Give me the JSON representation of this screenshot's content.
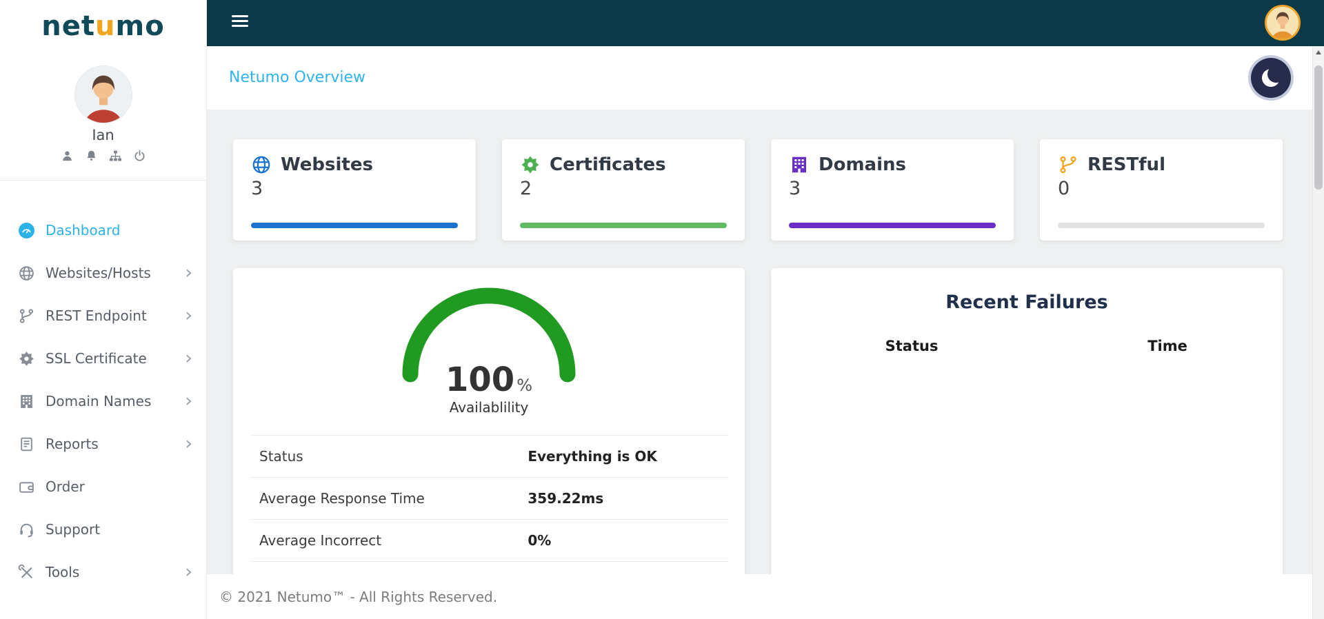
{
  "colors": {
    "topbar_bg": "#0b3948",
    "accent": "#2bb2e6",
    "title": "#2eb4ea"
  },
  "sidebar": {
    "logo": {
      "part1": "net",
      "part2": "u",
      "part3": "mo"
    },
    "user": {
      "name": "Ian"
    },
    "items": [
      {
        "label": "Dashboard",
        "icon": "speedometer-icon",
        "active": true,
        "chevron": false
      },
      {
        "label": "Websites/Hosts",
        "icon": "globe-icon",
        "active": false,
        "chevron": true
      },
      {
        "label": "REST Endpoint",
        "icon": "branch-icon",
        "active": false,
        "chevron": true
      },
      {
        "label": "SSL Certificate",
        "icon": "certificate-icon",
        "active": false,
        "chevron": true
      },
      {
        "label": "Domain Names",
        "icon": "building-icon",
        "active": false,
        "chevron": true
      },
      {
        "label": "Reports",
        "icon": "report-icon",
        "active": false,
        "chevron": true
      },
      {
        "label": "Order",
        "icon": "wallet-icon",
        "active": false,
        "chevron": false
      },
      {
        "label": "Support",
        "icon": "headset-icon",
        "active": false,
        "chevron": false
      },
      {
        "label": "Tools",
        "icon": "tools-icon",
        "active": false,
        "chevron": true
      }
    ]
  },
  "topbar": {
    "menu_icon": "hamburger-icon",
    "avatar_icon": "user-avatar"
  },
  "main": {
    "title": "Netumo Overview",
    "dark_mode_icon": "moon-icon",
    "cards": [
      {
        "label": "Websites",
        "value": "3",
        "icon": "globe-icon",
        "bar_color": "#1a73ce"
      },
      {
        "label": "Certificates",
        "value": "2",
        "icon": "certificate-icon",
        "bar_color": "#61bb63"
      },
      {
        "label": "Domains",
        "value": "3",
        "icon": "building-icon",
        "bar_color": "#6a2dc7"
      },
      {
        "label": "RESTful",
        "value": "0",
        "icon": "branch-icon",
        "bar_color": "#e2e3e5"
      }
    ],
    "availability": {
      "value": "100",
      "unit": "%",
      "label": "Availablility",
      "gauge_color": "#219a21",
      "rows": [
        {
          "label": "Status",
          "value": "Everything is OK"
        },
        {
          "label": "Average Response Time",
          "value": "359.22ms"
        },
        {
          "label": "Average Incorrect",
          "value": "0%"
        }
      ]
    },
    "recent_failures": {
      "title": "Recent Failures",
      "columns": [
        "Status",
        "Time"
      ]
    }
  },
  "footer": {
    "copyright": "© 2021 Netumo™ - All Rights Reserved."
  }
}
